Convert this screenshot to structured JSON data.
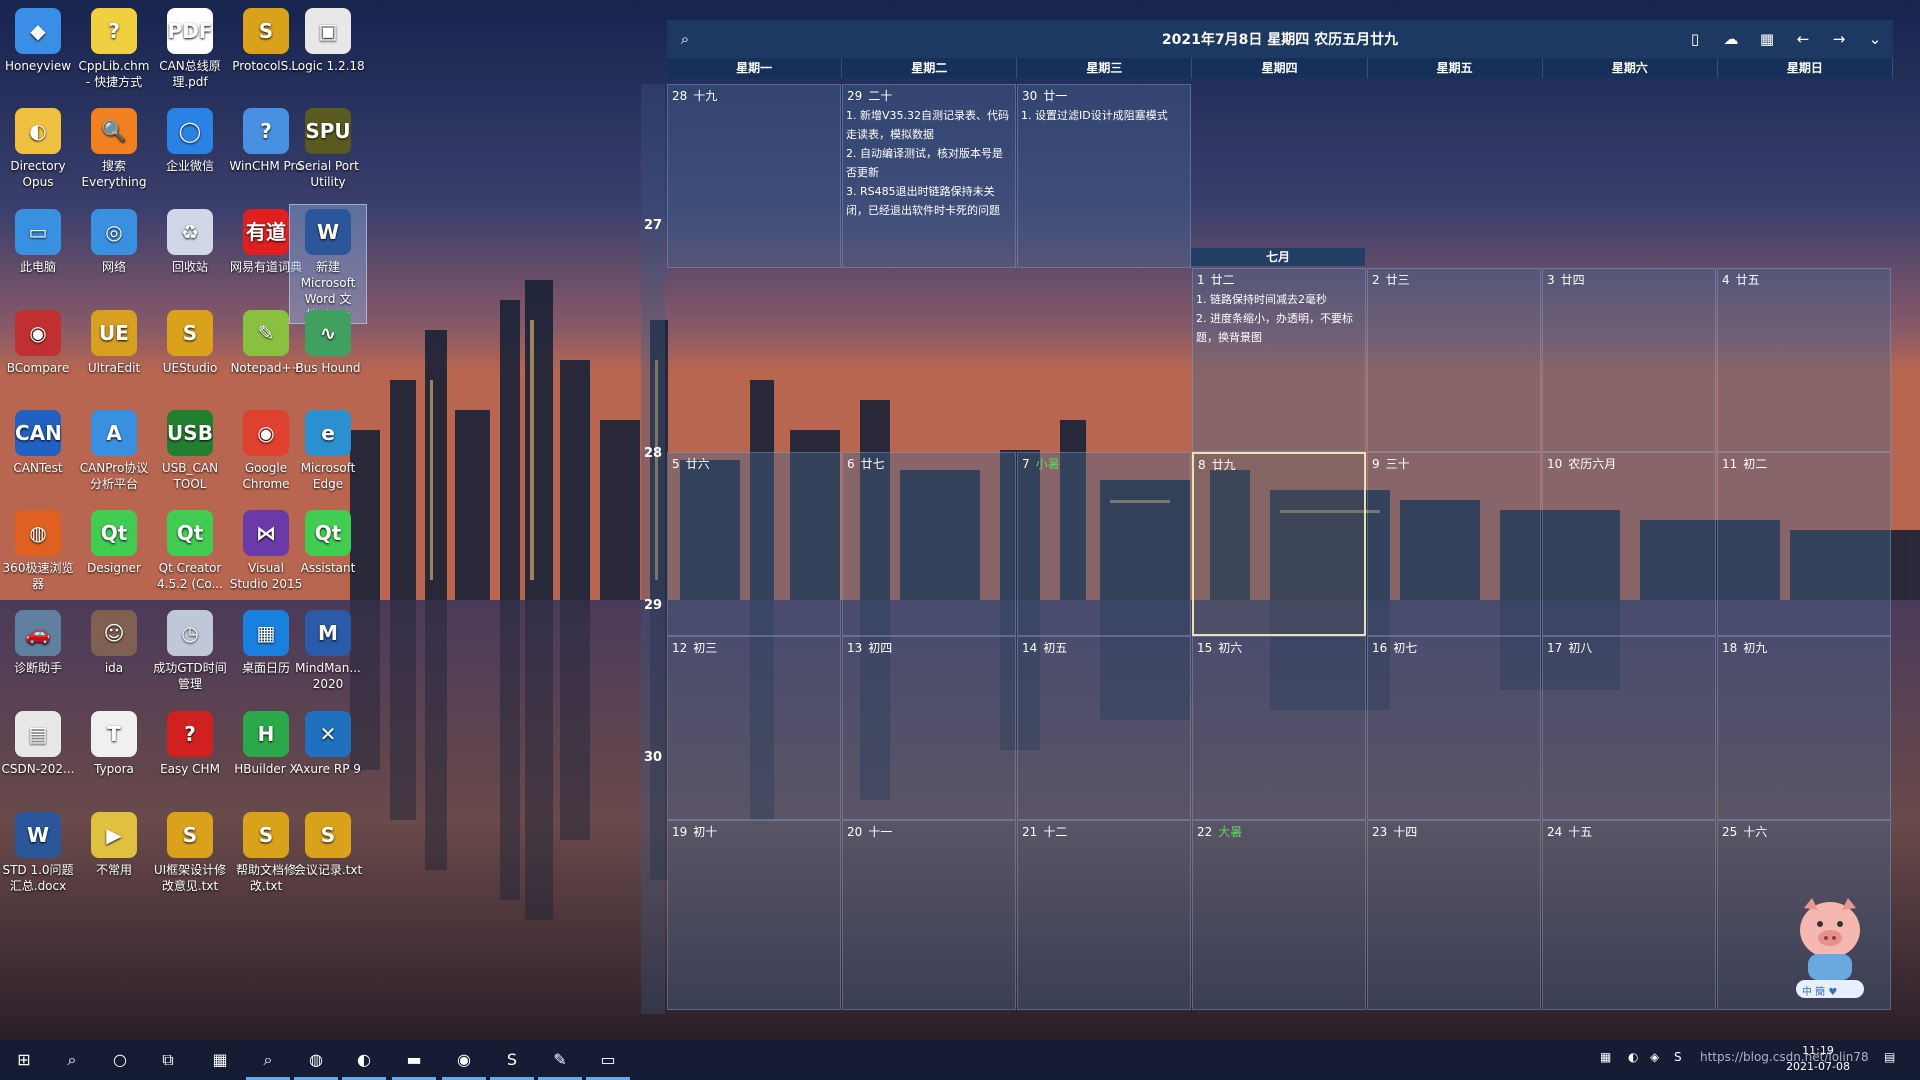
{
  "desktop_icons": [
    {
      "label": "Honeyview",
      "icon": "honeyview-icon",
      "color": "#3a8ee6",
      "glyph": "◆"
    },
    {
      "label": "CppLib.chm - 快捷方式",
      "icon": "chm-help-icon",
      "color": "#f0d040",
      "glyph": "?"
    },
    {
      "label": "CAN总线原理.pdf",
      "icon": "pdf-icon",
      "color": "#ffffff",
      "glyph": "PDF"
    },
    {
      "label": "ProtocolS...",
      "icon": "protocol-icon",
      "color": "#d9a21a",
      "glyph": "S"
    },
    {
      "label": "Logic 1.2.18",
      "icon": "logic-icon",
      "color": "#e8e8e8",
      "glyph": "▣"
    },
    {
      "label": "Directory Opus",
      "icon": "directory-opus-icon",
      "color": "#f0c040",
      "glyph": "◐"
    },
    {
      "label": "搜索 Everything",
      "icon": "everything-search-icon",
      "color": "#f08020",
      "glyph": "🔍"
    },
    {
      "label": "企业微信",
      "icon": "wecom-icon",
      "color": "#2a82e4",
      "glyph": "◯"
    },
    {
      "label": "WinCHM Pro",
      "icon": "winchm-icon",
      "color": "#4a90e2",
      "glyph": "?"
    },
    {
      "label": "Serial Port Utility",
      "icon": "serial-port-icon",
      "color": "#5a5a20",
      "glyph": "SPU"
    },
    {
      "label": "此电脑",
      "icon": "this-pc-icon",
      "color": "#3a90e0",
      "glyph": "▭"
    },
    {
      "label": "网络",
      "icon": "network-icon",
      "color": "#3a90e0",
      "glyph": "◎"
    },
    {
      "label": "回收站",
      "icon": "recycle-bin-icon",
      "color": "#d0d8e8",
      "glyph": "♻"
    },
    {
      "label": "网易有道词典",
      "icon": "youdao-icon",
      "color": "#e02020",
      "glyph": "有道"
    },
    {
      "label": "新建 Microsoft Word 文档.docx",
      "icon": "word-doc-icon",
      "color": "#2b579a",
      "glyph": "W"
    },
    {
      "label": "BCompare",
      "icon": "bcompare-icon",
      "color": "#c03030",
      "glyph": "◉"
    },
    {
      "label": "UltraEdit",
      "icon": "ultraedit-icon",
      "color": "#d8a020",
      "glyph": "UE"
    },
    {
      "label": "UEStudio",
      "icon": "uestudio-icon",
      "color": "#d9a21a",
      "glyph": "S"
    },
    {
      "label": "Notepad++",
      "icon": "notepadpp-icon",
      "color": "#8ac040",
      "glyph": "✎"
    },
    {
      "label": "Bus Hound",
      "icon": "bus-hound-icon",
      "color": "#40a060",
      "glyph": "∿"
    },
    {
      "label": "CANTest",
      "icon": "cantest-icon",
      "color": "#2060c0",
      "glyph": "CAN"
    },
    {
      "label": "CANPro协议分析平台",
      "icon": "canpro-icon",
      "color": "#3a90e0",
      "glyph": "A"
    },
    {
      "label": "USB_CAN TOOL",
      "icon": "usb-can-icon",
      "color": "#208030",
      "glyph": "USB"
    },
    {
      "label": "Google Chrome",
      "icon": "chrome-icon",
      "color": "#e04030",
      "glyph": "◉"
    },
    {
      "label": "Microsoft Edge",
      "icon": "edge-icon",
      "color": "#2a90d0",
      "glyph": "e"
    },
    {
      "label": "360极速浏览器",
      "icon": "browser-360-icon",
      "color": "#e06020",
      "glyph": "◍"
    },
    {
      "label": "Designer",
      "icon": "qt-designer-icon",
      "color": "#41cd52",
      "glyph": "Qt"
    },
    {
      "label": "Qt Creator 4.5.2 (Co...",
      "icon": "qt-creator-icon",
      "color": "#41cd52",
      "glyph": "Qt"
    },
    {
      "label": "Visual Studio 2015",
      "icon": "visual-studio-icon",
      "color": "#6a3aa8",
      "glyph": "⋈"
    },
    {
      "label": "Assistant",
      "icon": "qt-assistant-icon",
      "color": "#41cd52",
      "glyph": "Qt"
    },
    {
      "label": "诊断助手",
      "icon": "diagnosis-icon",
      "color": "#6080a0",
      "glyph": "🚗"
    },
    {
      "label": "ida",
      "icon": "ida-icon",
      "color": "#806050",
      "glyph": "☺"
    },
    {
      "label": "成功GTD时间管理",
      "icon": "gtd-icon",
      "color": "#c0c8d8",
      "glyph": "◷"
    },
    {
      "label": "桌面日历",
      "icon": "desktop-calendar-icon",
      "color": "#1a80e0",
      "glyph": "▦"
    },
    {
      "label": "MindMan... 2020",
      "icon": "mindmanager-icon",
      "color": "#2a5aa8",
      "glyph": "M"
    },
    {
      "label": "CSDN-202...",
      "icon": "csdn-file-icon",
      "color": "#e8e8e8",
      "glyph": "▤"
    },
    {
      "label": "Typora",
      "icon": "typora-icon",
      "color": "#f0f0f0",
      "glyph": "T"
    },
    {
      "label": "Easy CHM",
      "icon": "easy-chm-icon",
      "color": "#d02020",
      "glyph": "?"
    },
    {
      "label": "HBuilder X",
      "icon": "hbuilder-icon",
      "color": "#2aa84a",
      "glyph": "H"
    },
    {
      "label": "Axure RP 9",
      "icon": "axure-icon",
      "color": "#2070c0",
      "glyph": "✕"
    },
    {
      "label": "STD 1.0问题汇总.docx",
      "icon": "word-doc-icon",
      "color": "#2b579a",
      "glyph": "W"
    },
    {
      "label": "不常用",
      "icon": "folder-shortcut-icon",
      "color": "#e0c040",
      "glyph": "▶"
    },
    {
      "label": "UI框架设计修改意见.txt",
      "icon": "txt-file-icon",
      "color": "#d9a21a",
      "glyph": "S"
    },
    {
      "label": "帮助文档修改.txt",
      "icon": "txt-file-icon",
      "color": "#d9a21a",
      "glyph": "S"
    },
    {
      "label": "会议记录.txt",
      "icon": "txt-file-icon",
      "color": "#d9a21a",
      "glyph": "S"
    }
  ],
  "calendar": {
    "title": "2021年7月8日 星期四 农历五月廿九",
    "weekdays": [
      "星期一",
      "星期二",
      "星期三",
      "星期四",
      "星期五",
      "星期六",
      "星期日"
    ],
    "month_label": "七月",
    "week_numbers": [
      "27",
      "28",
      "29",
      "30"
    ],
    "rows": [
      [
        {
          "day": "28",
          "lunar": "十九",
          "notes": []
        },
        {
          "day": "29",
          "lunar": "二十",
          "notes": [
            "1. 新增V35.32自测记录表、代码走读表，模拟数据",
            "2. 自动编译测试，核对版本号是否更新",
            "3. RS485退出时链路保持未关闭，已经退出软件时卡死的问题"
          ]
        },
        {
          "day": "30",
          "lunar": "廿一",
          "notes": [
            "1. 设置过滤ID设计成阻塞模式"
          ]
        },
        null,
        null,
        null,
        null
      ],
      [
        null,
        null,
        null,
        {
          "day": "1",
          "lunar": "廿二",
          "notes": [
            "1. 链路保持时间减去2毫秒",
            "2. 进度条缩小，办透明，不要标题，换背景图"
          ]
        },
        {
          "day": "2",
          "lunar": "廿三",
          "notes": []
        },
        {
          "day": "3",
          "lunar": "廿四",
          "notes": []
        },
        {
          "day": "4",
          "lunar": "廿五",
          "notes": []
        }
      ],
      [
        {
          "day": "5",
          "lunar": "廿六",
          "notes": []
        },
        {
          "day": "6",
          "lunar": "廿七",
          "notes": []
        },
        {
          "day": "7",
          "term": "小暑",
          "notes": []
        },
        {
          "day": "8",
          "lunar": "廿九",
          "notes": [],
          "today": true
        },
        {
          "day": "9",
          "lunar": "三十",
          "notes": []
        },
        {
          "day": "10",
          "lunar": "农历六月",
          "notes": []
        },
        {
          "day": "11",
          "lunar": "初二",
          "notes": []
        }
      ],
      [
        {
          "day": "12",
          "lunar": "初三",
          "notes": []
        },
        {
          "day": "13",
          "lunar": "初四",
          "notes": []
        },
        {
          "day": "14",
          "lunar": "初五",
          "notes": []
        },
        {
          "day": "15",
          "lunar": "初六",
          "notes": []
        },
        {
          "day": "16",
          "lunar": "初七",
          "notes": []
        },
        {
          "day": "17",
          "lunar": "初八",
          "notes": []
        },
        {
          "day": "18",
          "lunar": "初九",
          "notes": []
        }
      ],
      [
        {
          "day": "19",
          "lunar": "初十",
          "notes": []
        },
        {
          "day": "20",
          "lunar": "十一",
          "notes": []
        },
        {
          "day": "21",
          "lunar": "十二",
          "notes": []
        },
        {
          "day": "22",
          "term": "大暑",
          "notes": []
        },
        {
          "day": "23",
          "lunar": "十四",
          "notes": []
        },
        {
          "day": "24",
          "lunar": "十五",
          "notes": []
        },
        {
          "day": "25",
          "lunar": "十六",
          "notes": []
        }
      ]
    ]
  },
  "taskbar": {
    "apps": [
      {
        "name": "start-button",
        "glyph": "⊞"
      },
      {
        "name": "search-taskbar-icon",
        "glyph": "⌕"
      },
      {
        "name": "cortana-icon",
        "glyph": "○"
      },
      {
        "name": "task-view-icon",
        "glyph": "⧉"
      },
      {
        "name": "calculator-taskbar-icon",
        "glyph": "▦"
      },
      {
        "name": "everything-taskbar-icon",
        "glyph": "⌕",
        "active": true
      },
      {
        "name": "browser-360-taskbar-icon",
        "glyph": "◍",
        "active": true
      },
      {
        "name": "directory-opus-taskbar-icon",
        "glyph": "◐",
        "active": true
      },
      {
        "name": "file-explorer-taskbar-icon",
        "glyph": "▬",
        "active": true
      },
      {
        "name": "chrome-taskbar-icon",
        "glyph": "◉",
        "active": true
      },
      {
        "name": "protocol-taskbar-icon",
        "glyph": "S",
        "active": true
      },
      {
        "name": "notepadpp-taskbar-icon",
        "glyph": "✎",
        "active": true
      },
      {
        "name": "terminal-taskbar-icon",
        "glyph": "▭",
        "active": true
      }
    ],
    "time": "11:19",
    "date": "2021-07-08",
    "watermark": "https://blog.csdn.net/lolin78",
    "mascot_label": "中 簡 ♥"
  }
}
